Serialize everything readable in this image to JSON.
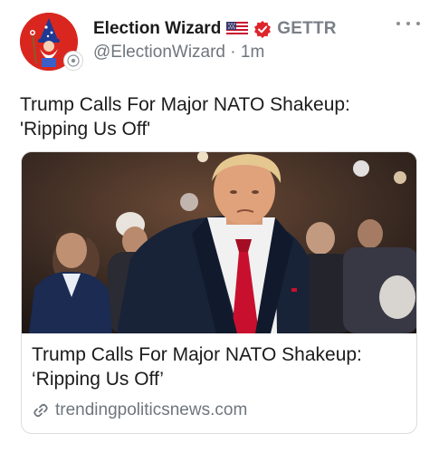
{
  "author": {
    "display_name": "Election Wizard",
    "flag_icon": "us-flag-icon",
    "verified_icon": "verified-badge-icon",
    "platform": "GETTR",
    "handle": "@ElectionWizard",
    "separator": "·",
    "time": "1m"
  },
  "post": {
    "text_line1": "Trump Calls For Major NATO Shakeup:",
    "text_line2": "'Ripping Us Off'"
  },
  "card": {
    "title_line1": "Trump Calls For Major NATO Shakeup:",
    "title_line2": "‘Ripping Us Off’",
    "link_icon": "link-icon",
    "domain": "trendingpoliticsnews.com"
  },
  "colors": {
    "avatar_red": "#d9271f",
    "verified_red": "#e0242b",
    "muted_text": "#6e767d",
    "tie_red": "#c8102e"
  }
}
